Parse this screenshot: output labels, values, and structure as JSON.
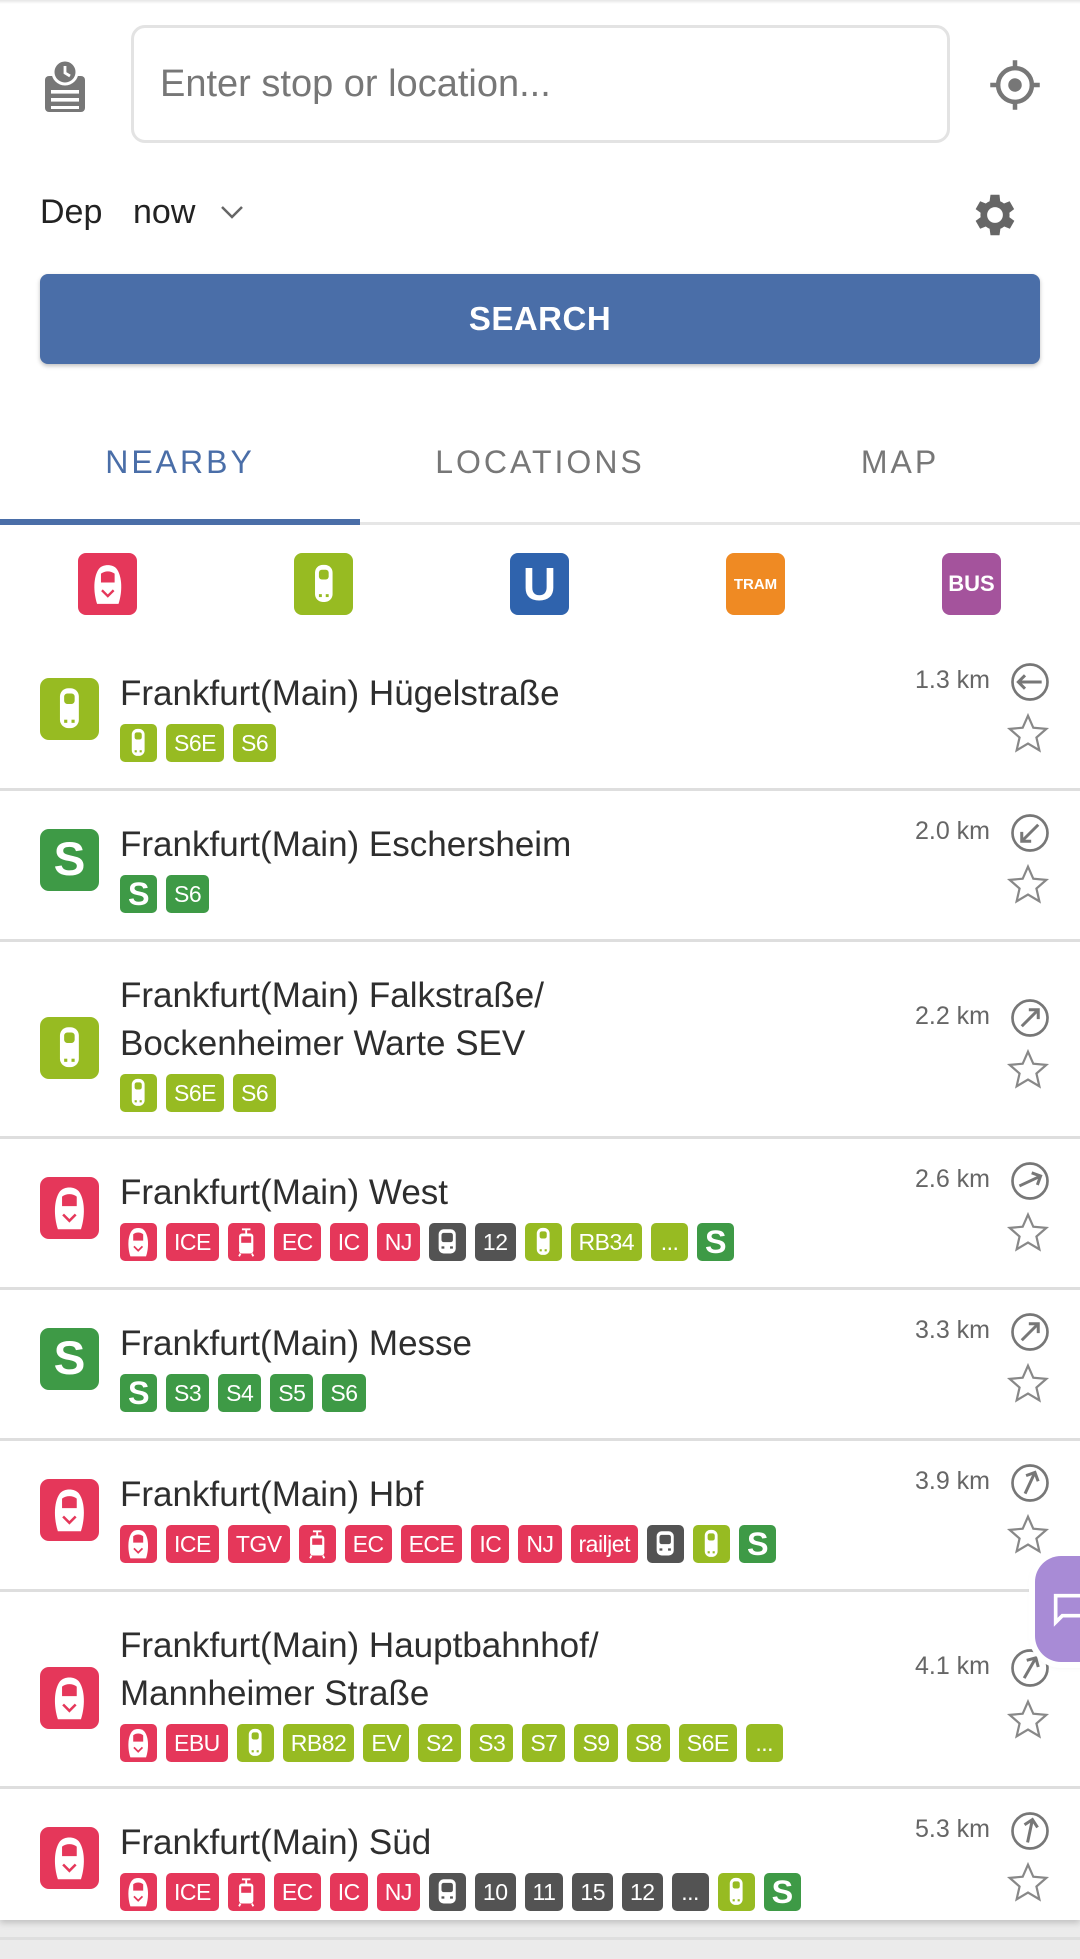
{
  "search": {
    "placeholder": "Enter stop or location...",
    "value": ""
  },
  "time": {
    "mode": "Dep",
    "value": "now"
  },
  "search_button": "SEARCH",
  "tabs": [
    {
      "label": "NEARBY",
      "active": true
    },
    {
      "label": "LOCATIONS",
      "active": false
    },
    {
      "label": "MAP",
      "active": false
    }
  ],
  "colors": {
    "accent": "#4a6ea8",
    "red": "#e5375a",
    "lime": "#97bb22",
    "green": "#3e9a46",
    "dark": "#535353",
    "ubahn": "#2f63ad",
    "tram": "#ef8a23",
    "bus": "#a4539c"
  },
  "filters": [
    {
      "icon": "ice-icon",
      "color": "red",
      "label": ""
    },
    {
      "icon": "regional-train-icon",
      "color": "lime",
      "label": ""
    },
    {
      "icon": "ubahn-icon",
      "color": "ubahn",
      "label": "U"
    },
    {
      "icon": "tram-icon",
      "color": "tram",
      "label": "TRAM"
    },
    {
      "icon": "bus-icon",
      "color": "bus",
      "label": "BUS"
    }
  ],
  "stations": [
    {
      "name": "Frankfurt(Main) Hügelstraße",
      "distance": "1.3 km",
      "bearing_deg": 270,
      "icon": "regional",
      "badges": [
        {
          "icon": "regional",
          "color": "lime"
        },
        {
          "label": "S6E",
          "color": "lime"
        },
        {
          "label": "S6",
          "color": "lime"
        }
      ]
    },
    {
      "name": "Frankfurt(Main) Eschersheim",
      "distance": "2.0 km",
      "bearing_deg": 225,
      "icon": "sbahn",
      "badges": [
        {
          "icon": "sbahn",
          "color": "green"
        },
        {
          "label": "S6",
          "color": "green"
        }
      ]
    },
    {
      "name": "Frankfurt(Main) Falkstraße/\nBockenheimer Warte SEV",
      "distance": "2.2 km",
      "bearing_deg": 45,
      "icon": "regional",
      "badges": [
        {
          "icon": "regional",
          "color": "lime"
        },
        {
          "label": "S6E",
          "color": "lime"
        },
        {
          "label": "S6",
          "color": "lime"
        }
      ]
    },
    {
      "name": "Frankfurt(Main) West",
      "distance": "2.6 km",
      "bearing_deg": 65,
      "icon": "ice",
      "badges": [
        {
          "icon": "ice",
          "color": "red"
        },
        {
          "label": "ICE",
          "color": "red"
        },
        {
          "icon": "train",
          "color": "red"
        },
        {
          "label": "EC",
          "color": "red"
        },
        {
          "label": "IC",
          "color": "red"
        },
        {
          "label": "NJ",
          "color": "red"
        },
        {
          "icon": "bus",
          "color": "dark"
        },
        {
          "label": "12",
          "color": "dark"
        },
        {
          "icon": "regional",
          "color": "lime"
        },
        {
          "label": "RB34",
          "color": "lime"
        },
        {
          "label": "...",
          "color": "lime"
        },
        {
          "icon": "sbahn",
          "color": "green"
        }
      ]
    },
    {
      "name": "Frankfurt(Main) Messe",
      "distance": "3.3 km",
      "bearing_deg": 45,
      "icon": "sbahn",
      "badges": [
        {
          "icon": "sbahn",
          "color": "green"
        },
        {
          "label": "S3",
          "color": "green"
        },
        {
          "label": "S4",
          "color": "green"
        },
        {
          "label": "S5",
          "color": "green"
        },
        {
          "label": "S6",
          "color": "green"
        }
      ]
    },
    {
      "name": "Frankfurt(Main) Hbf",
      "distance": "3.9 km",
      "bearing_deg": 25,
      "icon": "ice",
      "badges": [
        {
          "icon": "ice",
          "color": "red"
        },
        {
          "label": "ICE",
          "color": "red"
        },
        {
          "label": "TGV",
          "color": "red"
        },
        {
          "icon": "train",
          "color": "red"
        },
        {
          "label": "EC",
          "color": "red"
        },
        {
          "label": "ECE",
          "color": "red"
        },
        {
          "label": "IC",
          "color": "red"
        },
        {
          "label": "NJ",
          "color": "red"
        },
        {
          "label": "railjet",
          "color": "red"
        },
        {
          "icon": "bus",
          "color": "dark"
        },
        {
          "icon": "regional",
          "color": "lime"
        },
        {
          "icon": "sbahn",
          "color": "green"
        }
      ]
    },
    {
      "name": "Frankfurt(Main) Hauptbahnhof/\nMannheimer Straße",
      "distance": "4.1 km",
      "bearing_deg": 30,
      "icon": "ice",
      "badges": [
        {
          "icon": "ice",
          "color": "red"
        },
        {
          "label": "EBU",
          "color": "red"
        },
        {
          "icon": "regional",
          "color": "lime"
        },
        {
          "label": "RB82",
          "color": "lime"
        },
        {
          "label": "EV",
          "color": "lime"
        },
        {
          "label": "S2",
          "color": "lime"
        },
        {
          "label": "S3",
          "color": "lime"
        },
        {
          "label": "S7",
          "color": "lime"
        },
        {
          "label": "S9",
          "color": "lime"
        },
        {
          "label": "S8",
          "color": "lime"
        },
        {
          "label": "S6E",
          "color": "lime"
        },
        {
          "label": "...",
          "color": "lime"
        }
      ]
    },
    {
      "name": "Frankfurt(Main) Süd",
      "distance": "5.3 km",
      "bearing_deg": 12,
      "icon": "ice",
      "badges": [
        {
          "icon": "ice",
          "color": "red"
        },
        {
          "label": "ICE",
          "color": "red"
        },
        {
          "icon": "train",
          "color": "red"
        },
        {
          "label": "EC",
          "color": "red"
        },
        {
          "label": "IC",
          "color": "red"
        },
        {
          "label": "NJ",
          "color": "red"
        },
        {
          "icon": "bus",
          "color": "dark"
        },
        {
          "label": "10",
          "color": "dark"
        },
        {
          "label": "11",
          "color": "dark"
        },
        {
          "label": "15",
          "color": "dark"
        },
        {
          "label": "12",
          "color": "dark"
        },
        {
          "label": "...",
          "color": "dark"
        },
        {
          "icon": "regional",
          "color": "lime"
        },
        {
          "icon": "sbahn",
          "color": "green"
        }
      ]
    }
  ],
  "sbahn_logo": "S"
}
